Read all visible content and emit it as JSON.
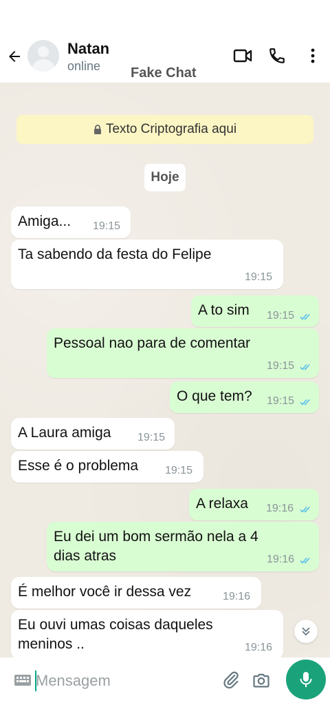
{
  "header": {
    "contact_name": "Natan",
    "status": "online",
    "app_label": "Fake Chat",
    "icons": [
      "back-arrow-icon",
      "avatar",
      "video-call-icon",
      "phone-icon",
      "more-vertical-icon"
    ]
  },
  "chat": {
    "encryption_notice": "Texto Criptografia aqui",
    "date_chip": "Hoje",
    "messages": [
      {
        "dir": "in",
        "text": "Amiga...",
        "time": "19:15"
      },
      {
        "dir": "in",
        "text": "Ta sabendo da festa do Felipe",
        "time": "19:15"
      },
      {
        "dir": "out",
        "text": "A to sim",
        "time": "19:15"
      },
      {
        "dir": "out",
        "text": "Pessoal nao para de comentar",
        "time": "19:15"
      },
      {
        "dir": "out",
        "text": "O que tem?",
        "time": "19:15"
      },
      {
        "dir": "in",
        "text": "A Laura amiga",
        "time": "19:15"
      },
      {
        "dir": "in",
        "text": "Esse é o problema",
        "time": "19:15"
      },
      {
        "dir": "out",
        "text": "A relaxa",
        "time": "19:16"
      },
      {
        "dir": "out",
        "text": "Eu dei um bom sermão nela a 4\ndias atras",
        "time": "19:16"
      },
      {
        "dir": "in",
        "text": "É melhor você ir dessa vez",
        "time": "19:16"
      },
      {
        "dir": "in",
        "text": "Eu ouvi umas coisas daqueles\nmeninos ..",
        "time": "19:16"
      }
    ]
  },
  "composer": {
    "placeholder": "Mensagem"
  },
  "colors": {
    "accent": "#1aa37a",
    "chat_bg": "#efeae2",
    "outgoing_bubble": "#d9fdd3",
    "incoming_bubble": "#ffffff",
    "read_ticks": "#53bdeb",
    "encryption_bg": "#fcf5c4"
  }
}
